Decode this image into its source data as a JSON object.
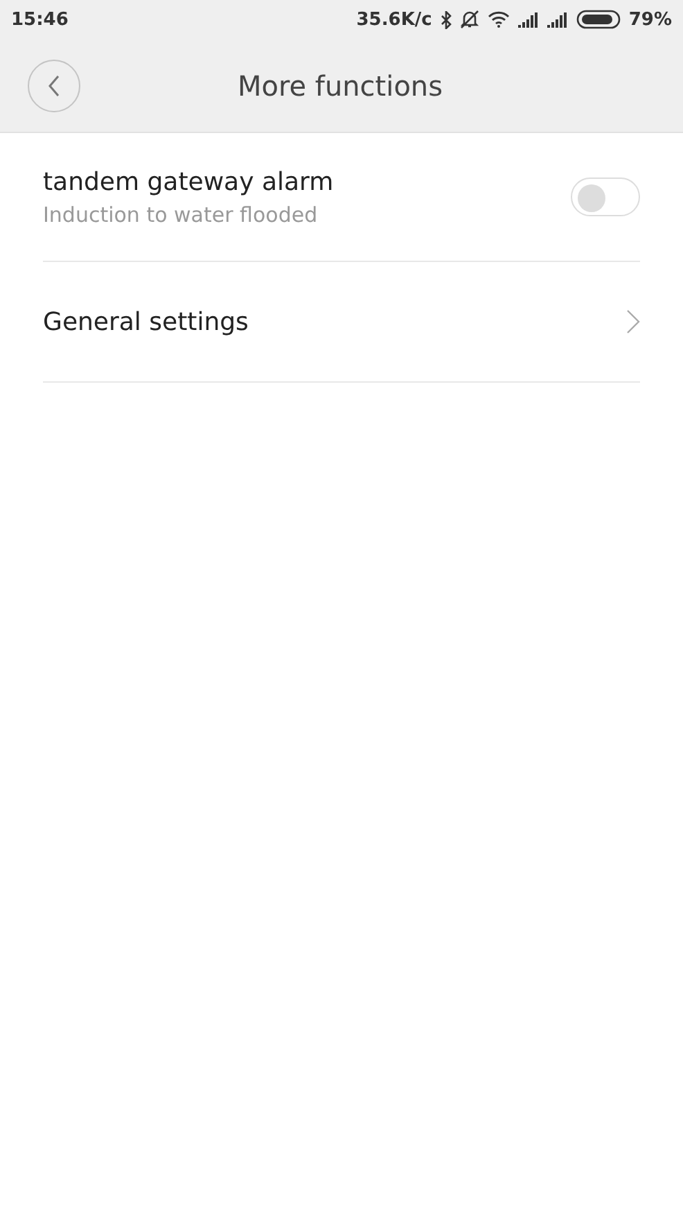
{
  "status_bar": {
    "time": "15:46",
    "net_speed": "35.6K/c",
    "battery_percent": "79%"
  },
  "header": {
    "title": "More functions"
  },
  "items": [
    {
      "kind": "toggle",
      "title": "tandem gateway alarm",
      "subtitle": "Induction to water flooded",
      "on": false
    },
    {
      "kind": "link",
      "title": "General settings"
    }
  ]
}
